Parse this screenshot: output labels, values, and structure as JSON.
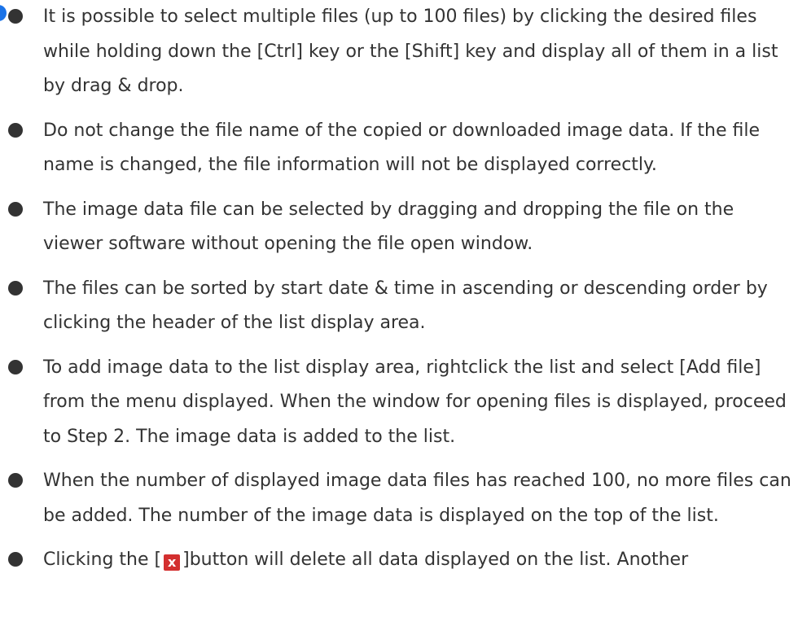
{
  "bullets": [
    "It is possible to select multiple files (up to 100 files) by clicking the desired files while holding down the [Ctrl] key or the [Shift] key and display all of them in a list by drag & drop.",
    "Do not change the file name of the copied or downloaded image data. If the file name is changed, the file information will not be displayed correctly.",
    "The image data file can be selected by dragging and dropping the file on the viewer software without opening the file open window.",
    "The files can be sorted by start date & time in ascending or descending order by clicking the header of the list display area.",
    "To add image data to the list display area, rightclick the list and select [Add file] from the menu displayed. When the window for opening files is displayed, proceed to Step 2. The image data is added to the list.",
    "When the number of displayed image data files has reached 100, no more files can be added. The number of the image data is displayed on the top of the list."
  ],
  "last_bullet": {
    "before": "Clicking the [",
    "icon": "delete-all-x-icon",
    "icon_glyph": "x",
    "icon_color": "#d32f2f",
    "after": "]button will delete all data displayed on the list. Another"
  },
  "colors": {
    "text": "#333333",
    "note_marker": "#1a73e8"
  }
}
